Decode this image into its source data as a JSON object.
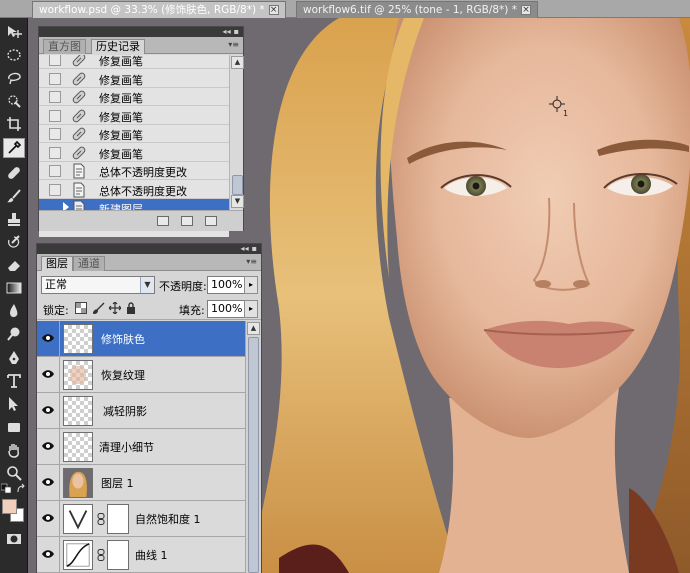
{
  "document_tabs": [
    {
      "title": "workflow.psd @ 33.3% (修饰肤色, RGB/8*) *",
      "active": true
    },
    {
      "title": "workflow6.tif @ 25% (tone - 1, RGB/8*) *",
      "active": false
    }
  ],
  "close_glyph": "×",
  "toolbox": {
    "tools": [
      "move-tool",
      "marquee-tool",
      "lasso-tool",
      "quick-selection-tool",
      "crop-tool",
      "eyedropper-tool",
      "healing-brush-tool",
      "brush-tool",
      "clone-stamp-tool",
      "history-brush-tool",
      "eraser-tool",
      "gradient-tool",
      "blur-tool",
      "dodge-tool",
      "pen-tool",
      "type-tool",
      "path-selection-tool",
      "rectangle-tool",
      "hand-tool",
      "zoom-tool"
    ],
    "selected_tool": "eyedropper-tool",
    "foreground_color": "#f0d0bd",
    "background_color": "#ffffff"
  },
  "history_panel": {
    "tabs": [
      {
        "label": "直方图",
        "active": false
      },
      {
        "label": "历史记录",
        "active": true
      }
    ],
    "items": [
      {
        "label": "修复画笔",
        "icon": "healing-brush-icon",
        "selected": false
      },
      {
        "label": "修复画笔",
        "icon": "healing-brush-icon",
        "selected": false
      },
      {
        "label": "修复画笔",
        "icon": "healing-brush-icon",
        "selected": false
      },
      {
        "label": "修复画笔",
        "icon": "healing-brush-icon",
        "selected": false
      },
      {
        "label": "修复画笔",
        "icon": "healing-brush-icon",
        "selected": false
      },
      {
        "label": "修复画笔",
        "icon": "healing-brush-icon",
        "selected": false
      },
      {
        "label": "总体不透明度更改",
        "icon": "document-icon",
        "selected": false
      },
      {
        "label": "总体不透明度更改",
        "icon": "document-icon",
        "selected": false
      },
      {
        "label": "新建图层",
        "icon": "document-icon",
        "selected": true
      }
    ]
  },
  "layers_panel": {
    "tabs": [
      {
        "label": "图层",
        "active": true
      },
      {
        "label": "通道",
        "active": false
      }
    ],
    "blend_mode": "正常",
    "opacity_label": "不透明度:",
    "opacity_value": "100%",
    "lock_label": "锁定:",
    "fill_label": "填充:",
    "fill_value": "100%",
    "layers": [
      {
        "name": "修饰肤色",
        "thumb": "transparent",
        "selected": true,
        "visible": true
      },
      {
        "name": "恢复纹理",
        "thumb": "transparent-skin",
        "selected": false,
        "visible": true
      },
      {
        "name": "减轻阴影",
        "thumb": "transparent",
        "selected": false,
        "visible": true
      },
      {
        "name": "清理小细节",
        "thumb": "transparent",
        "selected": false,
        "visible": true
      },
      {
        "name": "图层 1",
        "thumb": "photo",
        "selected": false,
        "visible": true
      },
      {
        "name": "自然饱和度 1",
        "thumb": "vibrance-adjustment",
        "selected": false,
        "visible": true
      },
      {
        "name": "曲线 1",
        "thumb": "curves-adjustment",
        "selected": false,
        "visible": true
      }
    ]
  }
}
